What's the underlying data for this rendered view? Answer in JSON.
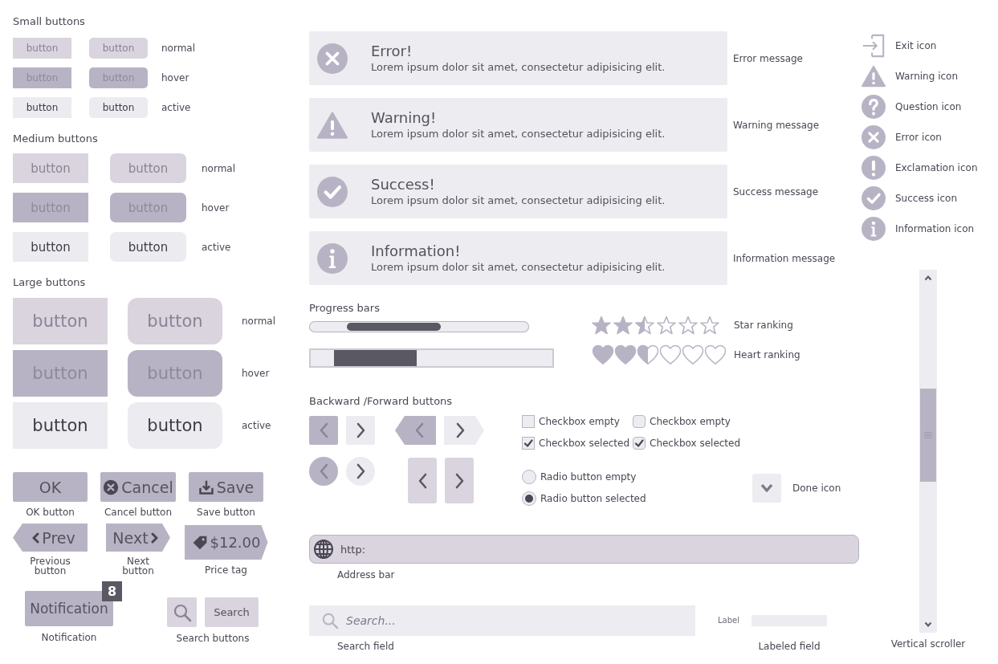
{
  "button_groups": [
    {
      "title": "Small buttons",
      "kind": "small",
      "rows": [
        {
          "state": "normal",
          "buttons": [
            {
              "kind": "square",
              "label": "button"
            },
            {
              "kind": "rounded",
              "label": "button"
            }
          ]
        },
        {
          "state": "hover",
          "buttons": [
            {
              "kind": "square",
              "label": "button"
            },
            {
              "kind": "rounded",
              "label": "button"
            }
          ]
        },
        {
          "state": "active",
          "buttons": [
            {
              "kind": "square",
              "label": "button"
            },
            {
              "kind": "rounded",
              "label": "button"
            }
          ]
        }
      ]
    },
    {
      "title": "Medium buttons",
      "kind": "medium",
      "rows": [
        {
          "state": "normal",
          "buttons": [
            {
              "kind": "square",
              "label": "button"
            },
            {
              "kind": "rounded",
              "label": "button"
            }
          ]
        },
        {
          "state": "hover",
          "buttons": [
            {
              "kind": "square",
              "label": "button"
            },
            {
              "kind": "rounded",
              "label": "button"
            }
          ]
        },
        {
          "state": "active",
          "buttons": [
            {
              "kind": "square",
              "label": "button"
            },
            {
              "kind": "rounded",
              "label": "button"
            }
          ]
        }
      ]
    },
    {
      "title": "Large buttons",
      "kind": "large",
      "rows": [
        {
          "state": "normal",
          "buttons": [
            {
              "kind": "square",
              "label": "button"
            },
            {
              "kind": "rounded",
              "label": "button"
            }
          ]
        },
        {
          "state": "hover",
          "buttons": [
            {
              "kind": "square",
              "label": "button"
            },
            {
              "kind": "rounded",
              "label": "button"
            }
          ]
        },
        {
          "state": "active",
          "buttons": [
            {
              "kind": "square",
              "label": "button"
            },
            {
              "kind": "rounded",
              "label": "button"
            }
          ]
        }
      ]
    }
  ],
  "action_buttons": [
    {
      "kind": "ok",
      "label": "OK",
      "caption": "OK button"
    },
    {
      "kind": "cancel",
      "label": "Cancel",
      "caption": "Cancel button"
    },
    {
      "kind": "save",
      "label": "Save",
      "caption": "Save button"
    },
    {
      "kind": "prev",
      "label": "Prev",
      "caption": "Previous button"
    },
    {
      "kind": "next",
      "label": "Next",
      "caption": "Next button"
    },
    {
      "kind": "price",
      "label": "$12.00",
      "caption": "Price tag"
    }
  ],
  "notification": {
    "label": "Notification",
    "badge": "8",
    "caption": "Notification"
  },
  "search_buttons": {
    "label": "Search",
    "caption": "Search buttons"
  },
  "messages": [
    {
      "kind": "error",
      "title": "Error!",
      "text": "Lorem ipsum dolor sit amet, consectetur adipisicing elit.",
      "caption": "Error message"
    },
    {
      "kind": "warning",
      "title": "Warning!",
      "text": "Lorem ipsum dolor sit amet, consectetur adipisicing elit.",
      "caption": "Warning message"
    },
    {
      "kind": "success",
      "title": "Success!",
      "text": "Lorem ipsum dolor sit amet, consectetur adipisicing elit.",
      "caption": "Success message"
    },
    {
      "kind": "info",
      "title": "Information!",
      "text": "Lorem ipsum dolor sit amet, consectetur adipisicing elit.",
      "caption": "Information message"
    }
  ],
  "progress": {
    "title": "Progress bars",
    "bars": [
      {
        "kind": "rounded",
        "level": 0.43
      },
      {
        "kind": "flat"
      }
    ]
  },
  "ratings": [
    {
      "kind": "star",
      "stars": 2.5,
      "caption": "Star ranking"
    },
    {
      "kind": "heart",
      "stars": 2.5,
      "caption": "Heart ranking"
    }
  ],
  "nav_buttons": {
    "title": "Backward /Forward buttons",
    "rows": [
      [
        {
          "kind": "square",
          "buttons": [
            {
              "kind": "back",
              "selected": true
            },
            {
              "kind": "forward",
              "selected": false
            }
          ]
        },
        {
          "kind": "arrow",
          "buttons": [
            {
              "kind": "back",
              "selected": true
            },
            {
              "kind": "forward",
              "selected": false
            }
          ]
        }
      ],
      [
        {
          "kind": "circle",
          "buttons": [
            {
              "kind": "back",
              "selected": true
            },
            {
              "kind": "forward",
              "selected": false
            }
          ]
        },
        {
          "kind": "tall",
          "buttons": [
            {
              "kind": "back",
              "selected": false
            },
            {
              "kind": "forward",
              "selected": false
            }
          ]
        }
      ]
    ]
  },
  "checkboxes": [
    {
      "kind": "square",
      "label": "Checkbox empty",
      "checked": false
    },
    {
      "kind": "rounded",
      "label": "Checkbox empty",
      "checked": false
    },
    {
      "kind": "square",
      "label": "Checkbox selected",
      "checked": true
    },
    {
      "kind": "rounded",
      "label": "Checkbox selected",
      "checked": true
    }
  ],
  "radios": [
    {
      "label": "Radio button empty",
      "selected": false
    },
    {
      "label": "Radio button selected",
      "selected": true
    }
  ],
  "done": {
    "caption": "Done icon"
  },
  "address_bar": {
    "value": "http:",
    "caption": "Address bar"
  },
  "search_field": {
    "placeholder": "Search...",
    "caption": "Search field"
  },
  "labeled_field": {
    "label": "Label",
    "caption": "Labeled field"
  },
  "icons": [
    {
      "kind": "exit",
      "label": "Exit icon"
    },
    {
      "kind": "warning",
      "label": "Warning icon"
    },
    {
      "kind": "question",
      "label": "Question icon"
    },
    {
      "kind": "error",
      "label": "Error icon"
    },
    {
      "kind": "exclamation",
      "label": "Exclamation icon"
    },
    {
      "kind": "success",
      "label": "Success icon"
    },
    {
      "kind": "info",
      "label": "Information icon"
    }
  ],
  "scroller": {
    "caption": "Vertical scroller"
  }
}
